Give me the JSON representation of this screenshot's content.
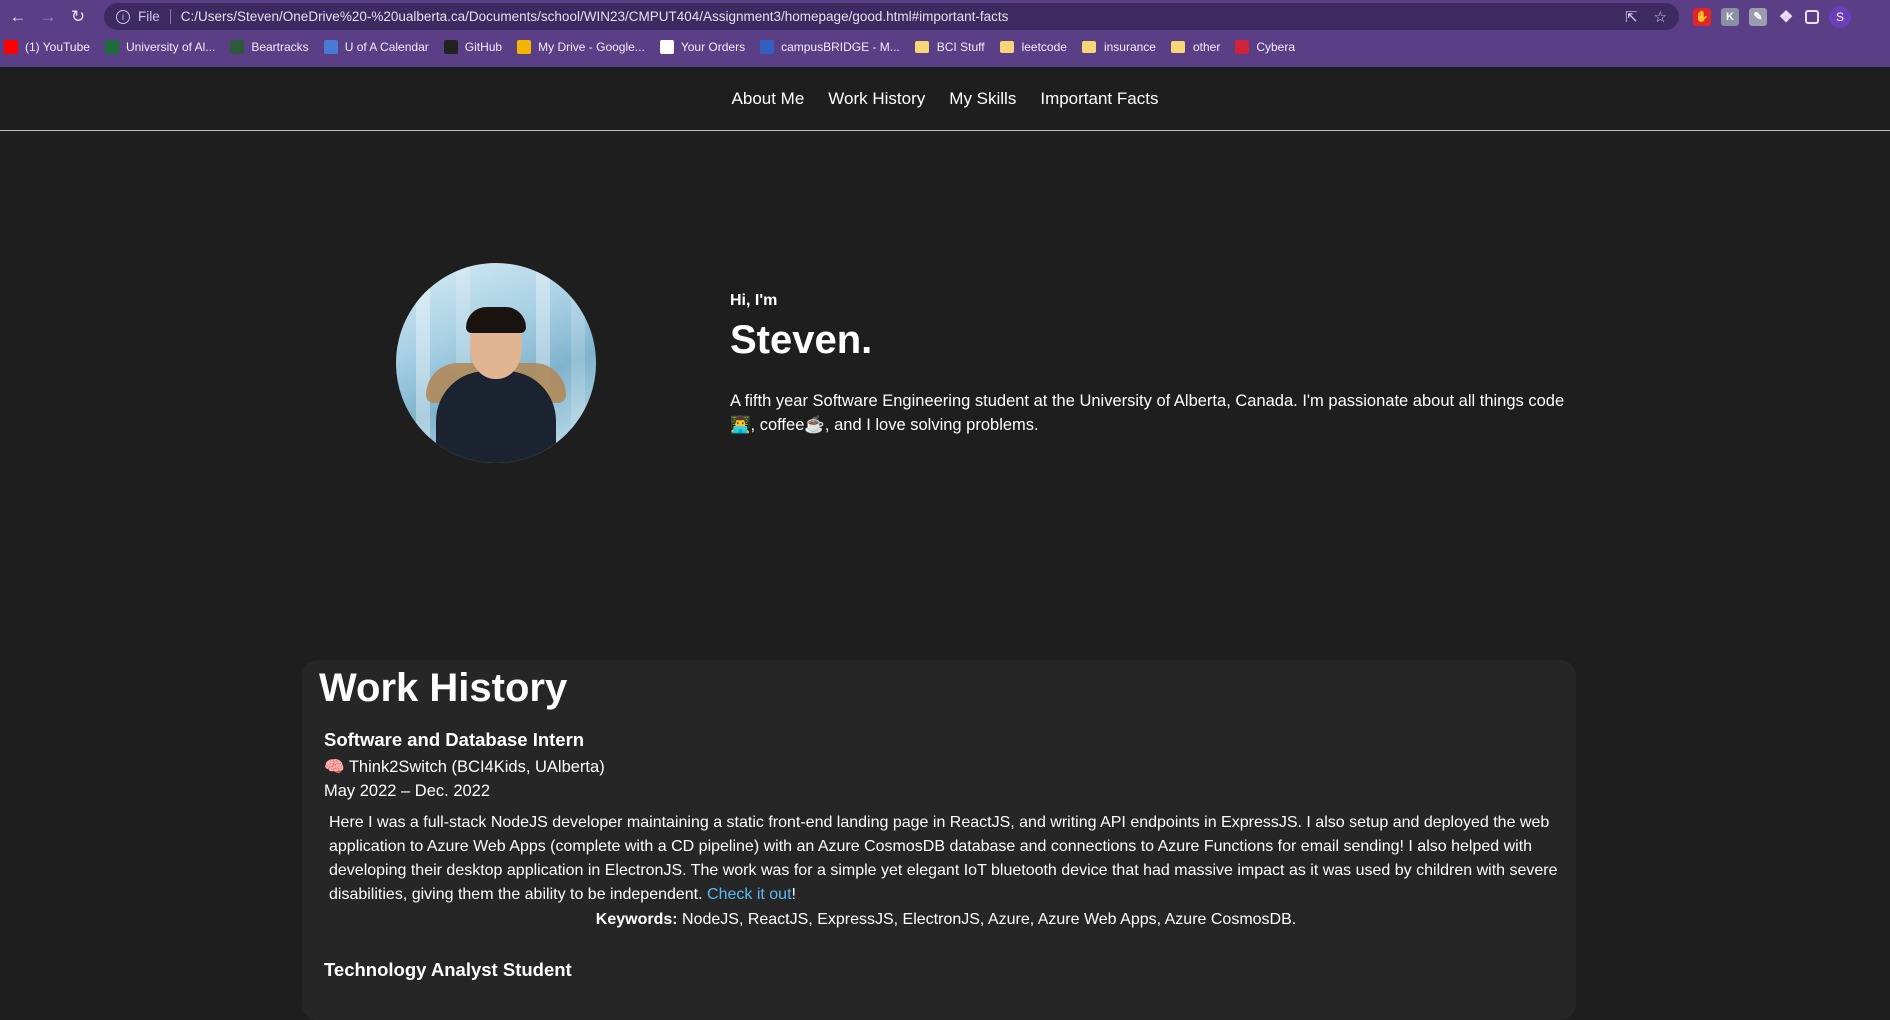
{
  "browser": {
    "url_scheme": "File",
    "url": "C:/Users/Steven/OneDrive%20-%20ualberta.ca/Documents/school/WIN23/CMPUT404/Assignment3/homepage/good.html#important-facts",
    "profile_initial": "S",
    "bookmarks": [
      {
        "label": "(1) YouTube",
        "icon": "youtube-icon",
        "color": "#ff0000"
      },
      {
        "label": "University of Al...",
        "icon": "ualberta-icon",
        "color": "#1d6b3a"
      },
      {
        "label": "Beartracks",
        "icon": "beartracks-icon",
        "color": "#2d5a3a"
      },
      {
        "label": "U of A Calendar",
        "icon": "calendar-icon",
        "color": "#4a7ad8"
      },
      {
        "label": "GitHub",
        "icon": "github-icon",
        "color": "#222222"
      },
      {
        "label": "My Drive - Google...",
        "icon": "drive-icon",
        "color": "#f4b400"
      },
      {
        "label": "Your Orders",
        "icon": "amazon-icon",
        "color": "#ffffff"
      },
      {
        "label": "campusBRIDGE - M...",
        "icon": "campusbridge-icon",
        "color": "#3060c0"
      },
      {
        "label": "BCI Stuff",
        "icon": "folder-icon",
        "color": "#f6d675"
      },
      {
        "label": "leetcode",
        "icon": "folder-icon",
        "color": "#f6d675"
      },
      {
        "label": "insurance",
        "icon": "folder-icon",
        "color": "#f6d675"
      },
      {
        "label": "other",
        "icon": "folder-icon",
        "color": "#f6d675"
      },
      {
        "label": "Cybera",
        "icon": "cybera-icon",
        "color": "#d0223a"
      }
    ]
  },
  "nav": {
    "items": [
      "About Me",
      "Work History",
      "My Skills",
      "Important Facts"
    ]
  },
  "hero": {
    "greeting": "Hi, I'm",
    "name": "Steven.",
    "bio_part1": "A fifth year Software Engineering student at the University of Alberta, Canada. I'm passionate about all things code",
    "bio_emoji1": "👨‍💻",
    "bio_part2": ", coffee",
    "bio_emoji2": "☕",
    "bio_part3": ", and I love solving problems."
  },
  "work": {
    "heading": "Work History",
    "jobs": [
      {
        "title": "Software and Database Intern",
        "company_emoji": "🧠",
        "company": "Think2Switch (BCI4Kids, UAlberta)",
        "dates": "May 2022 – Dec. 2022",
        "description": "Here I was a full-stack NodeJS developer maintaining a static front-end landing page in ReactJS, and writing API endpoints in ExpressJS. I also setup and deployed the web application to Azure Web Apps (complete with a CD pipeline) with an Azure CosmosDB database and connections to Azure Functions for email sending! I also helped with developing their desktop application in ElectronJS. The work was for a simple yet elegant IoT bluetooth device that had massive impact as it was used by children with severe disabilities, giving them the ability to be independent.",
        "link_text": "Check it out",
        "link_suffix": "!",
        "keywords_label": "Keywords:",
        "keywords": "NodeJS, ReactJS, ExpressJS, ElectronJS, Azure, Azure Web Apps, Azure CosmosDB."
      },
      {
        "title": "Technology Analyst Student"
      }
    ]
  }
}
